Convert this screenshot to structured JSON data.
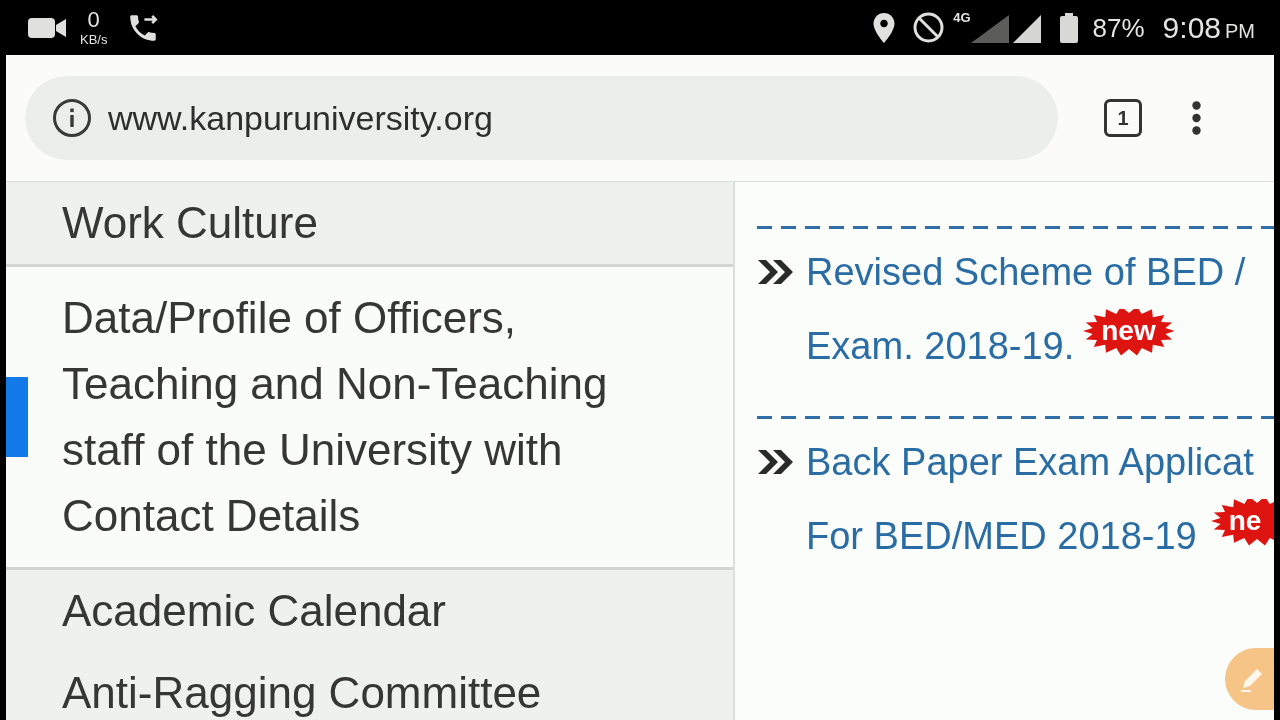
{
  "status_bar": {
    "network_speed": "0",
    "network_speed_unit": "KB/s",
    "network_type": "4G",
    "battery": "87%",
    "time": "9:08",
    "time_period": "PM"
  },
  "browser": {
    "url": "www.kanpuruniversity.org",
    "tab_count": "1"
  },
  "menu": {
    "items": [
      {
        "label": "Work Culture",
        "selected": false
      },
      {
        "label": "Data/Profile of Officers, Teaching and Non-Teaching staff of the University with Contact Details",
        "selected": true
      },
      {
        "label": "Academic Calendar",
        "selected": false
      },
      {
        "label": "Anti-Ragging Committee",
        "selected": false
      }
    ]
  },
  "notices": [
    {
      "lines": [
        "Revised Scheme of BED /",
        "Exam. 2018-19."
      ],
      "badge": "new"
    },
    {
      "lines": [
        "Back Paper Exam Applicat",
        "For BED/MED 2018-19"
      ],
      "badge": "ne"
    }
  ]
}
